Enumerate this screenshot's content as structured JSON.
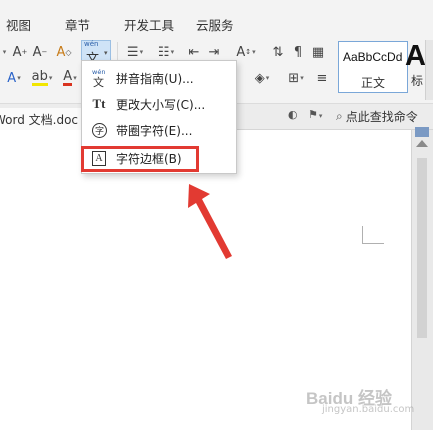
{
  "menu": {
    "tabs": [
      "视图",
      "章节",
      "开发工具",
      "云服务"
    ]
  },
  "ribbon": {
    "style_sample": "AaBbCcDd",
    "style_name": "正文",
    "big_style_glyph": "A",
    "big_style_label": "标"
  },
  "phonetic_button": {
    "top_glyph": "wén",
    "main_glyph": "文"
  },
  "doc_tab": {
    "title": "Word 文档.doc"
  },
  "search_command": {
    "label": "点此查找命令"
  },
  "dropdown": {
    "items": [
      {
        "label": "拼音指南(U)...",
        "icon": "pinyin-guide-icon",
        "icon_top": "wén",
        "icon_main": "文"
      },
      {
        "label": "更改大小写(C)...",
        "icon": "change-case-icon",
        "icon_text": "Tt"
      },
      {
        "label": "带圈字符(E)...",
        "icon": "enclosed-char-icon",
        "icon_text": "字"
      },
      {
        "label": "字符边框(B)",
        "icon": "char-border-icon",
        "icon_text": "A"
      }
    ]
  },
  "highlight": {
    "target": "字符边框(B)",
    "color": "#e23a32"
  },
  "arrow": {
    "color": "#e23a32"
  },
  "watermark": {
    "main": "Baidu 经验",
    "sub": "jingyan.baidu.com"
  },
  "colors": {
    "ribbon_bg": "#f3f3f3",
    "accent_blue": "#cfe3f7",
    "font_red": "#d9331f",
    "highlight_yellow": "#f2e600"
  }
}
